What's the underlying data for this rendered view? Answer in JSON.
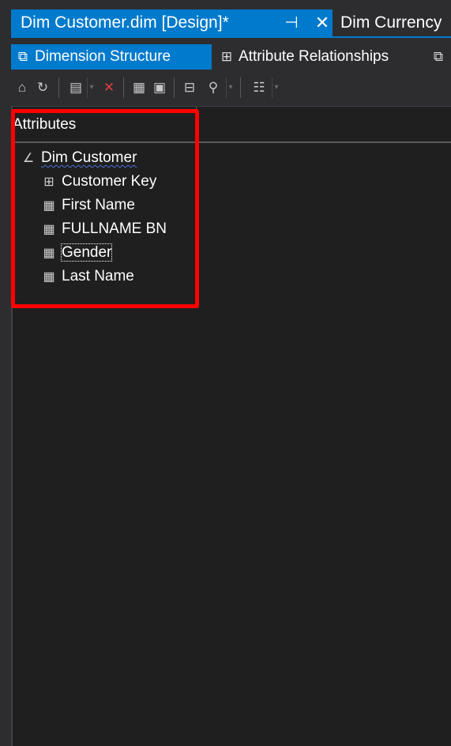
{
  "document_tabs": [
    {
      "title": "Dim Customer.dim [Design]*",
      "active": true,
      "pin_icon": "pin-icon",
      "close_icon": "close-icon"
    },
    {
      "title": "Dim Currency",
      "active": false
    }
  ],
  "designer_tabs": [
    {
      "label": "Dimension Structure",
      "icon": "dimension-structure-icon",
      "active": true
    },
    {
      "label": "Attribute Relationships",
      "icon": "attribute-relationships-icon",
      "active": false
    },
    {
      "label": "",
      "icon": "translations-icon",
      "active": false
    }
  ],
  "toolbar": {
    "buttons": [
      "process-icon",
      "refresh-icon",
      "show-table-icon",
      "delete-icon",
      "grid-view-icon",
      "list-view-icon",
      "explore-data-icon",
      "zoom-icon",
      "hierarchy-icon"
    ]
  },
  "attributes_pane": {
    "header": "Attributes",
    "root": {
      "label": "Dim Customer",
      "icon": "dimension-icon"
    },
    "items": [
      {
        "label": "Customer Key",
        "icon": "key-attribute-icon"
      },
      {
        "label": "First Name",
        "icon": "attribute-icon"
      },
      {
        "label": "FULLNAME BN",
        "icon": "attribute-icon"
      },
      {
        "label": "Gender",
        "icon": "attribute-icon",
        "focused": true
      },
      {
        "label": "Last Name",
        "icon": "attribute-icon"
      }
    ]
  },
  "colors": {
    "accent": "#007acc",
    "background": "#2d2d30",
    "pane_background": "#1f1f1f",
    "highlight": "#ff0000"
  }
}
